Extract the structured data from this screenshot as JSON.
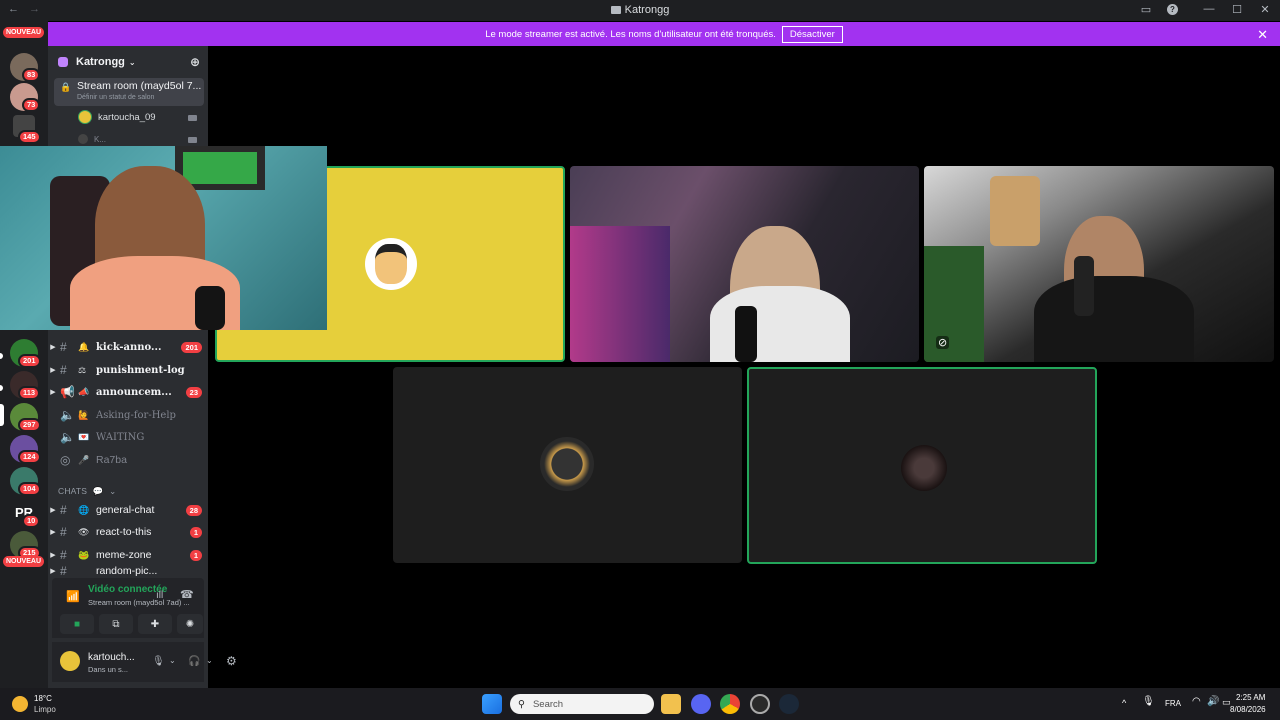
{
  "window": {
    "title": "Katrongg"
  },
  "banner": {
    "message": "Le mode streamer est activé. Les noms d'utilisateur ont été tronqués.",
    "button": "Désactiver"
  },
  "rail": {
    "nouveau_top": "NOUVEAU",
    "nouveau_bottom": "NOUVEAU",
    "badges": [
      "83",
      "73",
      "145",
      "201",
      "113",
      "297",
      "124",
      "104",
      "10",
      "215"
    ]
  },
  "sidebar": {
    "guild_name": "Katrongg",
    "stream_room": {
      "name": "Stream room (mayd5ol 7...",
      "status": "Définir un statut de salon"
    },
    "voice_users": [
      "kartoucha_09",
      "K..."
    ],
    "channels": [
      {
        "type": "text",
        "emoji": "🔔",
        "label": "kick-anno...",
        "count": "201",
        "bold": true
      },
      {
        "type": "text",
        "emoji": "⚖",
        "label": "punishment-log",
        "count": "",
        "bold": true
      },
      {
        "type": "announce",
        "emoji": "📣",
        "label": "announcem...",
        "count": "23",
        "bold": true
      },
      {
        "type": "voice",
        "emoji": "🙋",
        "label": "Asking-for-Help",
        "count": "",
        "bold": false
      },
      {
        "type": "voice",
        "emoji": "💌",
        "label": "WAITING",
        "count": "",
        "bold": false
      },
      {
        "type": "stage",
        "emoji": "🎤",
        "label": "Ra7ba",
        "count": "",
        "bold": false
      }
    ],
    "category": "CHATS",
    "chat_channels": [
      {
        "emoji": "🌐",
        "label": "general-chat",
        "count": "28"
      },
      {
        "emoji": "👁",
        "label": "react-to-this",
        "count": "1"
      },
      {
        "emoji": "🐸",
        "label": "meme-zone",
        "count": "1"
      },
      {
        "emoji": "",
        "label": "random-pic...",
        "count": ""
      }
    ],
    "voice_panel": {
      "status": "Vidéo connectée",
      "channel": "Stream room (mayd5ol 7ad) ..."
    },
    "user": {
      "name": "kartouch...",
      "status": "Dans un s..."
    }
  },
  "taskbar": {
    "weather_temp": "18°C",
    "weather_text": "Limpo",
    "search_placeholder": "Search",
    "lang": "FRA",
    "time": "2:25 AM",
    "date": "8/08/2026"
  },
  "colors": {
    "banner": "#a232f0",
    "speaking": "#23a55a",
    "badge": "#f23f43",
    "tile_yellow": "#e6cf3b"
  }
}
